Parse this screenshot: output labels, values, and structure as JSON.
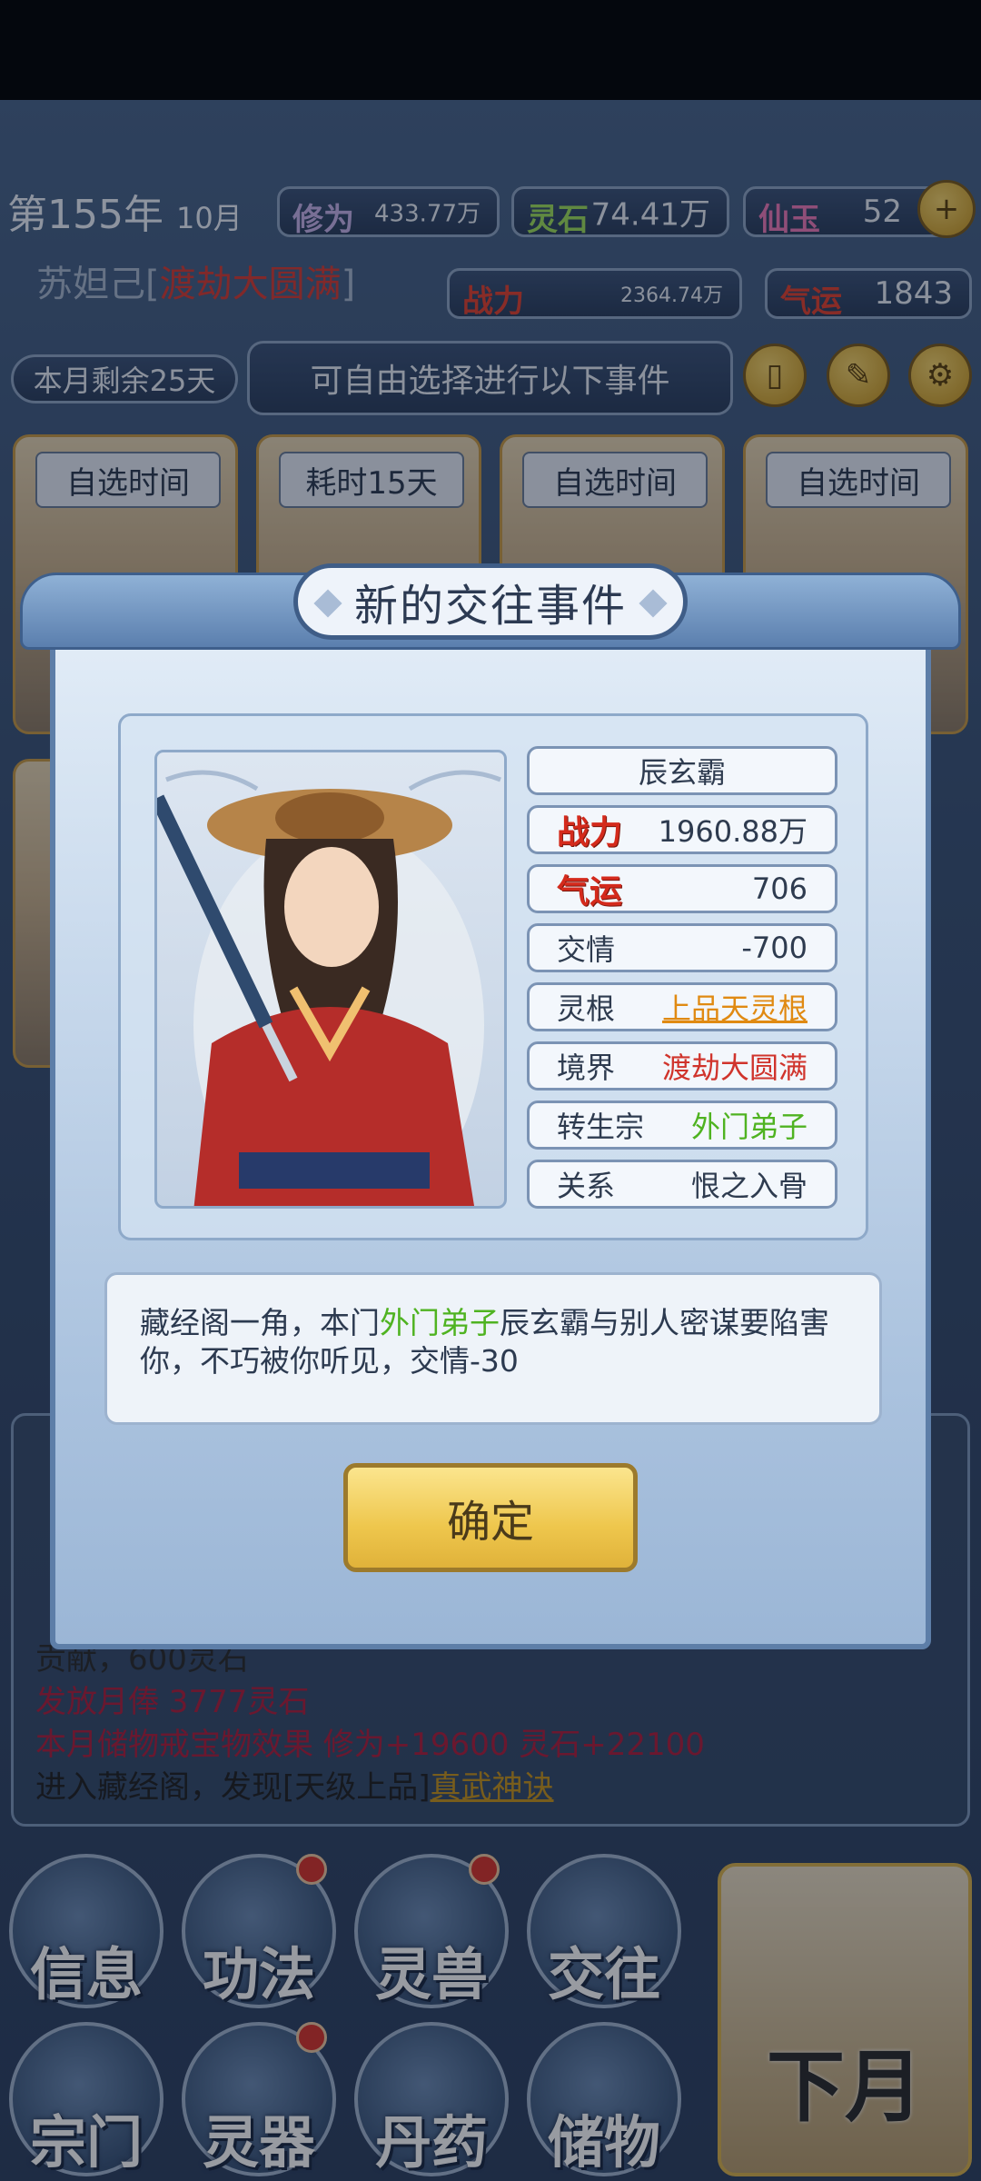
{
  "header": {
    "year_label": "第155年",
    "month_label": "10月",
    "xiuwei": {
      "key": "修为",
      "value": "433.77万"
    },
    "lingshi": {
      "key": "灵石",
      "value": "74.41万"
    },
    "xianyu": {
      "key": "仙玉",
      "value": "52"
    },
    "player_name": "苏妲己",
    "player_realm": "渡劫大圆满",
    "zhanli": {
      "key": "战力",
      "value": "2364.74万"
    },
    "qiyun": {
      "key": "气运",
      "value": "1843"
    }
  },
  "events_bar": {
    "days_left": "本月剩余25天",
    "prompt": "可自由选择进行以下事件",
    "cards": [
      "自选时间",
      "耗时15天",
      "自选时间",
      "自选时间"
    ]
  },
  "log": {
    "lines": [
      {
        "text": "贡献，600灵石",
        "color": "#2a2a2a"
      },
      {
        "text": "发放月俸 3777灵石",
        "color": "#b01e3c"
      },
      {
        "text": "本月储物戒宝物效果 修为+19600 灵石+22100",
        "color": "#b01e3c"
      },
      {
        "text": "进入藏经阁，发现[天级上品]",
        "color": "#1f1f1f"
      }
    ],
    "link": "真武神诀"
  },
  "menu": {
    "items": [
      "信息",
      "功法",
      "灵兽",
      "交往",
      "宗门",
      "灵器",
      "丹药",
      "储物"
    ],
    "next_month": "下月"
  },
  "modal": {
    "title": "新的交往事件",
    "npc": {
      "name": "辰玄霸",
      "zhanli": {
        "key": "战力",
        "value": "1960.88万"
      },
      "qiyun": {
        "key": "气运",
        "value": "706"
      },
      "jiaoqing": {
        "key": "交情",
        "value": "-700"
      },
      "linggen": {
        "key": "灵根",
        "value": "上品天灵根"
      },
      "jingjie": {
        "key": "境界",
        "value": "渡劫大圆满"
      },
      "zhuansheng": {
        "key": "转生宗",
        "value": "外门弟子"
      },
      "guanxi": {
        "key": "关系",
        "value": "恨之入骨"
      }
    },
    "desc": {
      "part1": "藏经阁一角，本门",
      "highlight": "外门弟子",
      "part2": "辰玄霸与别人密谋要陷害你，不巧被你听见，交情-30"
    },
    "confirm_label": "确定"
  },
  "colors": {
    "red_value": "#d0342c",
    "orange_value": "#e08a12",
    "green_value": "#4fb321",
    "gold_button": "#eec64c"
  }
}
